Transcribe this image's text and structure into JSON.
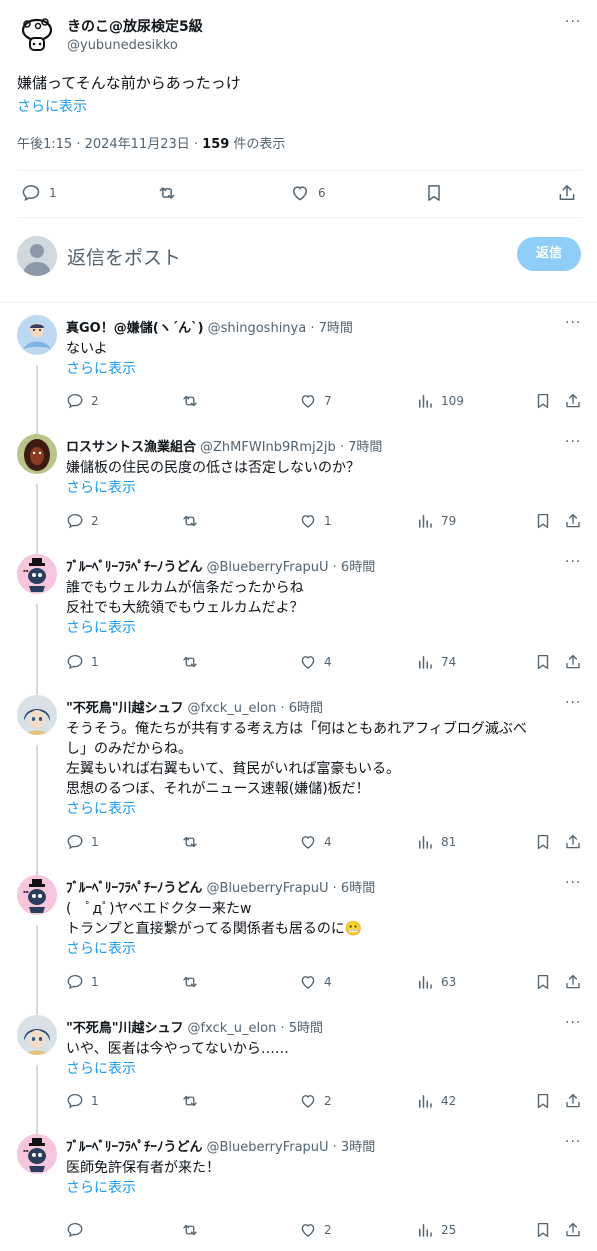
{
  "main_tweet": {
    "display_name": "きのこ@放尿検定5級",
    "handle": "@yubunedesikko",
    "more": "···",
    "text": "嫌儲ってそんな前からあったっけ",
    "show_more": "さらに表示",
    "time": "午後1:15 · 2024年11月23日 · ",
    "views": "159",
    "views_suffix": " 件の表示",
    "replies": "1",
    "likes": "6"
  },
  "reply_box": {
    "placeholder": "返信をポスト",
    "button": "返信"
  },
  "replies": [
    {
      "name": "真GO！@嫌儲(ヽ´ん`)",
      "handle": "@shingoshinya · 7時間",
      "lines": [
        "ないよ"
      ],
      "show_more": "さらに表示",
      "replies": "2",
      "retweets": "",
      "likes": "7",
      "views": "109"
    },
    {
      "name": "ロスサントス漁業組合",
      "handle": "@ZhMFWInb9Rmj2jb · 7時間",
      "lines": [
        "嫌儲板の住民の民度の低さは否定しないのか？"
      ],
      "show_more": "さらに表示",
      "replies": "2",
      "retweets": "",
      "likes": "1",
      "views": "79"
    },
    {
      "name": "ﾌﾞﾙｰﾍﾞﾘｰﾌﾗﾍﾟﾁｰﾉうどん",
      "handle": "@BlueberryFrapuU · 6時間",
      "lines": [
        "誰でもウェルカムが信条だったからね",
        "反社でも大統領でもウェルカムだよ？"
      ],
      "show_more": "さらに表示",
      "replies": "1",
      "retweets": "",
      "likes": "4",
      "views": "74"
    },
    {
      "name": "\"不死鳥\"川越シュフ",
      "handle": "@fxck_u_elon · 6時間",
      "lines": [
        "そうそう。俺たちが共有する考え方は「何はともあれアフィブログ滅ぶべ",
        "し」のみだからね。",
        "左翼もいれば右翼もいて、貧民がいれば富豪もいる。",
        "思想のるつぼ、それがニュース速報(嫌儲)板だ！"
      ],
      "show_more": "さらに表示",
      "replies": "1",
      "retweets": "",
      "likes": "4",
      "views": "81"
    },
    {
      "name": "ﾌﾞﾙｰﾍﾞﾘｰﾌﾗﾍﾟﾁｰﾉうどん",
      "handle": "@BlueberryFrapuU · 6時間",
      "lines": [
        "(　ﾟдﾟ)ヤベエドクター来たw",
        "トランプと直接繋がってる関係者も居るのに😬"
      ],
      "show_more": "さらに表示",
      "replies": "1",
      "retweets": "",
      "likes": "4",
      "views": "63"
    },
    {
      "name": "\"不死鳥\"川越シュフ",
      "handle": "@fxck_u_elon · 5時間",
      "lines": [
        "いや、医者は今やってないから……"
      ],
      "show_more": "さらに表示",
      "replies": "1",
      "retweets": "",
      "likes": "2",
      "views": "42"
    },
    {
      "name": "ﾌﾞﾙｰﾍﾞﾘｰﾌﾗﾍﾟﾁｰﾉうどん",
      "handle": "@BlueberryFrapuU · 3時間",
      "lines": [
        "医師免許保有者が来た！"
      ],
      "show_more": "さらに表示",
      "replies": "",
      "retweets": "",
      "likes": "2",
      "views": "25"
    }
  ],
  "colors": {
    "link": "#1d9bf0",
    "secondary_text": "#536471",
    "reply_button": "#8ecdf8"
  }
}
